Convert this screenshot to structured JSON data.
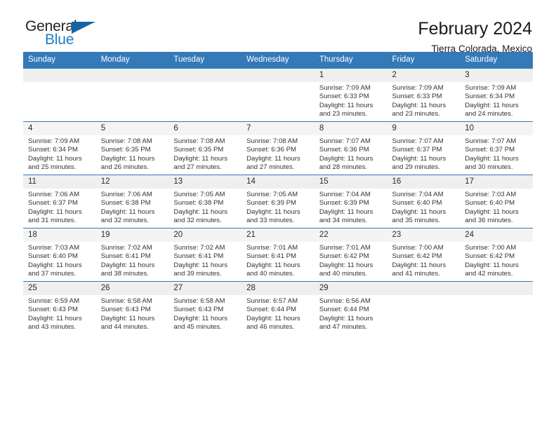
{
  "logo": {
    "word_top": "General",
    "word_bottom": "Blue",
    "accent_color": "#1464a5",
    "text_color": "#231f20"
  },
  "header": {
    "month_title": "February 2024",
    "location": "Tierra Colorada, Mexico",
    "header_bg": "#3479b8"
  },
  "weekday_headers": [
    "Sunday",
    "Monday",
    "Tuesday",
    "Wednesday",
    "Thursday",
    "Friday",
    "Saturday"
  ],
  "weeks": [
    [
      {
        "day": "",
        "empty": true
      },
      {
        "day": "",
        "empty": true
      },
      {
        "day": "",
        "empty": true
      },
      {
        "day": "",
        "empty": true
      },
      {
        "day": "1",
        "sunrise": "Sunrise: 7:09 AM",
        "sunset": "Sunset: 6:33 PM",
        "daylight1": "Daylight: 11 hours",
        "daylight2": "and 23 minutes."
      },
      {
        "day": "2",
        "sunrise": "Sunrise: 7:09 AM",
        "sunset": "Sunset: 6:33 PM",
        "daylight1": "Daylight: 11 hours",
        "daylight2": "and 23 minutes."
      },
      {
        "day": "3",
        "sunrise": "Sunrise: 7:09 AM",
        "sunset": "Sunset: 6:34 PM",
        "daylight1": "Daylight: 11 hours",
        "daylight2": "and 24 minutes."
      }
    ],
    [
      {
        "day": "4",
        "sunrise": "Sunrise: 7:09 AM",
        "sunset": "Sunset: 6:34 PM",
        "daylight1": "Daylight: 11 hours",
        "daylight2": "and 25 minutes."
      },
      {
        "day": "5",
        "sunrise": "Sunrise: 7:08 AM",
        "sunset": "Sunset: 6:35 PM",
        "daylight1": "Daylight: 11 hours",
        "daylight2": "and 26 minutes."
      },
      {
        "day": "6",
        "sunrise": "Sunrise: 7:08 AM",
        "sunset": "Sunset: 6:35 PM",
        "daylight1": "Daylight: 11 hours",
        "daylight2": "and 27 minutes."
      },
      {
        "day": "7",
        "sunrise": "Sunrise: 7:08 AM",
        "sunset": "Sunset: 6:36 PM",
        "daylight1": "Daylight: 11 hours",
        "daylight2": "and 27 minutes."
      },
      {
        "day": "8",
        "sunrise": "Sunrise: 7:07 AM",
        "sunset": "Sunset: 6:36 PM",
        "daylight1": "Daylight: 11 hours",
        "daylight2": "and 28 minutes."
      },
      {
        "day": "9",
        "sunrise": "Sunrise: 7:07 AM",
        "sunset": "Sunset: 6:37 PM",
        "daylight1": "Daylight: 11 hours",
        "daylight2": "and 29 minutes."
      },
      {
        "day": "10",
        "sunrise": "Sunrise: 7:07 AM",
        "sunset": "Sunset: 6:37 PM",
        "daylight1": "Daylight: 11 hours",
        "daylight2": "and 30 minutes."
      }
    ],
    [
      {
        "day": "11",
        "sunrise": "Sunrise: 7:06 AM",
        "sunset": "Sunset: 6:37 PM",
        "daylight1": "Daylight: 11 hours",
        "daylight2": "and 31 minutes."
      },
      {
        "day": "12",
        "sunrise": "Sunrise: 7:06 AM",
        "sunset": "Sunset: 6:38 PM",
        "daylight1": "Daylight: 11 hours",
        "daylight2": "and 32 minutes."
      },
      {
        "day": "13",
        "sunrise": "Sunrise: 7:05 AM",
        "sunset": "Sunset: 6:38 PM",
        "daylight1": "Daylight: 11 hours",
        "daylight2": "and 32 minutes."
      },
      {
        "day": "14",
        "sunrise": "Sunrise: 7:05 AM",
        "sunset": "Sunset: 6:39 PM",
        "daylight1": "Daylight: 11 hours",
        "daylight2": "and 33 minutes."
      },
      {
        "day": "15",
        "sunrise": "Sunrise: 7:04 AM",
        "sunset": "Sunset: 6:39 PM",
        "daylight1": "Daylight: 11 hours",
        "daylight2": "and 34 minutes."
      },
      {
        "day": "16",
        "sunrise": "Sunrise: 7:04 AM",
        "sunset": "Sunset: 6:40 PM",
        "daylight1": "Daylight: 11 hours",
        "daylight2": "and 35 minutes."
      },
      {
        "day": "17",
        "sunrise": "Sunrise: 7:03 AM",
        "sunset": "Sunset: 6:40 PM",
        "daylight1": "Daylight: 11 hours",
        "daylight2": "and 36 minutes."
      }
    ],
    [
      {
        "day": "18",
        "sunrise": "Sunrise: 7:03 AM",
        "sunset": "Sunset: 6:40 PM",
        "daylight1": "Daylight: 11 hours",
        "daylight2": "and 37 minutes."
      },
      {
        "day": "19",
        "sunrise": "Sunrise: 7:02 AM",
        "sunset": "Sunset: 6:41 PM",
        "daylight1": "Daylight: 11 hours",
        "daylight2": "and 38 minutes."
      },
      {
        "day": "20",
        "sunrise": "Sunrise: 7:02 AM",
        "sunset": "Sunset: 6:41 PM",
        "daylight1": "Daylight: 11 hours",
        "daylight2": "and 39 minutes."
      },
      {
        "day": "21",
        "sunrise": "Sunrise: 7:01 AM",
        "sunset": "Sunset: 6:41 PM",
        "daylight1": "Daylight: 11 hours",
        "daylight2": "and 40 minutes."
      },
      {
        "day": "22",
        "sunrise": "Sunrise: 7:01 AM",
        "sunset": "Sunset: 6:42 PM",
        "daylight1": "Daylight: 11 hours",
        "daylight2": "and 40 minutes."
      },
      {
        "day": "23",
        "sunrise": "Sunrise: 7:00 AM",
        "sunset": "Sunset: 6:42 PM",
        "daylight1": "Daylight: 11 hours",
        "daylight2": "and 41 minutes."
      },
      {
        "day": "24",
        "sunrise": "Sunrise: 7:00 AM",
        "sunset": "Sunset: 6:42 PM",
        "daylight1": "Daylight: 11 hours",
        "daylight2": "and 42 minutes."
      }
    ],
    [
      {
        "day": "25",
        "sunrise": "Sunrise: 6:59 AM",
        "sunset": "Sunset: 6:43 PM",
        "daylight1": "Daylight: 11 hours",
        "daylight2": "and 43 minutes."
      },
      {
        "day": "26",
        "sunrise": "Sunrise: 6:58 AM",
        "sunset": "Sunset: 6:43 PM",
        "daylight1": "Daylight: 11 hours",
        "daylight2": "and 44 minutes."
      },
      {
        "day": "27",
        "sunrise": "Sunrise: 6:58 AM",
        "sunset": "Sunset: 6:43 PM",
        "daylight1": "Daylight: 11 hours",
        "daylight2": "and 45 minutes."
      },
      {
        "day": "28",
        "sunrise": "Sunrise: 6:57 AM",
        "sunset": "Sunset: 6:44 PM",
        "daylight1": "Daylight: 11 hours",
        "daylight2": "and 46 minutes."
      },
      {
        "day": "29",
        "sunrise": "Sunrise: 6:56 AM",
        "sunset": "Sunset: 6:44 PM",
        "daylight1": "Daylight: 11 hours",
        "daylight2": "and 47 minutes."
      },
      {
        "day": "",
        "empty": true
      },
      {
        "day": "",
        "empty": true
      }
    ]
  ]
}
